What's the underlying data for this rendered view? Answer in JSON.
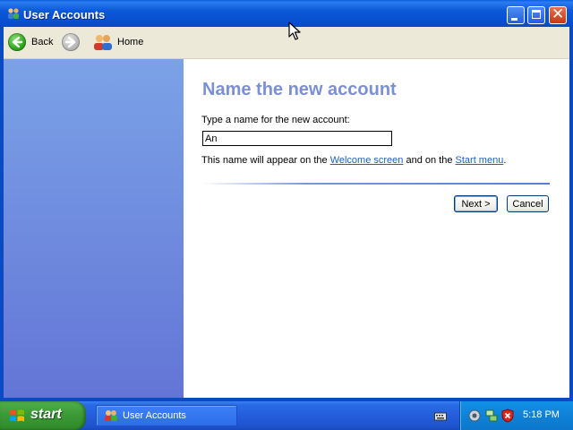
{
  "window": {
    "title": "User Accounts",
    "icon": "user-accounts-icon"
  },
  "toolbar": {
    "back_label": "Back",
    "forward_icon": "forward-arrow-icon",
    "home_label": "Home"
  },
  "content": {
    "heading": "Name the new account",
    "prompt": "Type a name for the new account:",
    "account_name_value": "An",
    "note_prefix": "This name will appear on the ",
    "note_link_welcome": "Welcome screen",
    "note_middle": " and on the ",
    "note_link_start_menu": "Start menu",
    "note_suffix": ".",
    "next_label": "Next >",
    "cancel_label": "Cancel"
  },
  "taskbar": {
    "start_label": "start",
    "task_item_label": "User Accounts",
    "clock": "5:18 PM"
  },
  "colors": {
    "titlebar": "#0b58d8",
    "heading": "#7b8fd4",
    "link": "#215dc6",
    "left_pane_top": "#7ba2e7",
    "left_pane_bottom": "#6375d6",
    "start_button": "#3c9b36"
  }
}
